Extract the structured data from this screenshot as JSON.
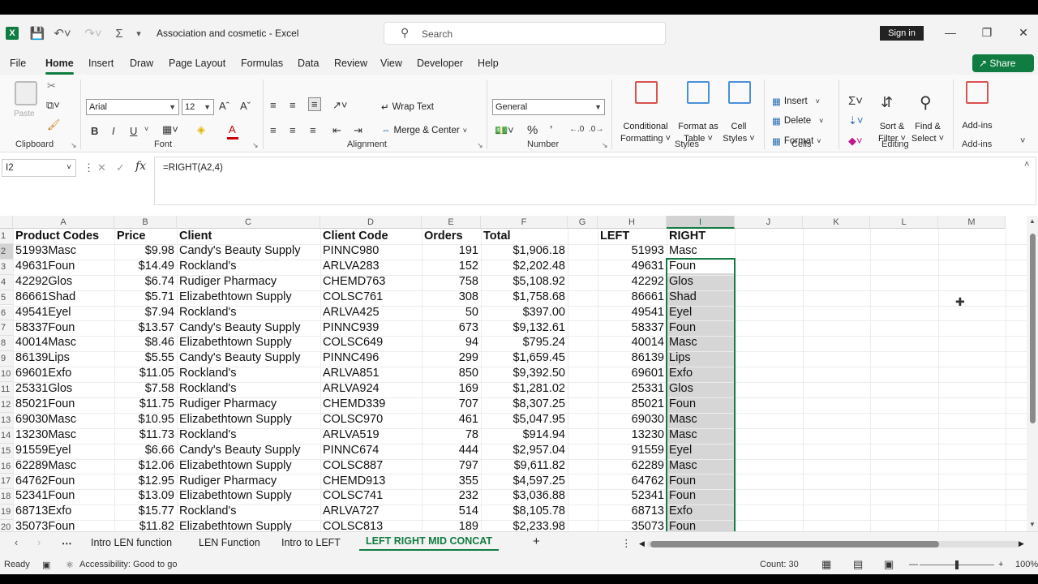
{
  "app": {
    "logo_letter": "X",
    "doc_title": "Association and cosmetic  -  Excel",
    "search_placeholder": "Search",
    "sign_in": "Sign in",
    "share": "Share"
  },
  "menu": [
    "File",
    "Home",
    "Insert",
    "Draw",
    "Page Layout",
    "Formulas",
    "Data",
    "Review",
    "View",
    "Developer",
    "Help"
  ],
  "ribbon": {
    "font_name": "Arial",
    "font_size": "12",
    "wrap_text": "Wrap Text",
    "merge_center": "Merge & Center",
    "number_format": "General",
    "conditional_formatting": [
      "Conditional",
      "Formatting"
    ],
    "format_as_table": [
      "Format as",
      "Table"
    ],
    "cell_styles": [
      "Cell",
      "Styles"
    ],
    "insert": "Insert",
    "delete": "Delete",
    "format": "Format",
    "sort_filter": [
      "Sort &",
      "Filter"
    ],
    "find_select": [
      "Find &",
      "Select"
    ],
    "addins": "Add-ins",
    "groups": {
      "clipboard": "Clipboard",
      "font": "Font",
      "alignment": "Alignment",
      "number": "Number",
      "styles": "Styles",
      "cells": "Cells",
      "editing": "Editing",
      "addins": "Add-ins"
    },
    "paste": "Paste"
  },
  "formula_bar": {
    "name_box": "I2",
    "fx": "fx",
    "formula": "=RIGHT(A2,4)"
  },
  "columns": [
    "A",
    "B",
    "C",
    "D",
    "E",
    "F",
    "G",
    "H",
    "I",
    "J",
    "K",
    "L",
    "M"
  ],
  "headers": [
    "Product Codes",
    "Price",
    "Client",
    "Client Code",
    "Orders",
    "Total",
    "",
    "LEFT",
    "RIGHT"
  ],
  "rows": [
    [
      "51993Masc",
      "$9.98",
      "Candy's Beauty Supply",
      "PINNC980",
      "191",
      "$1,906.18",
      "",
      "51993",
      "Masc"
    ],
    [
      "49631Foun",
      "$14.49",
      "Rockland's",
      "ARLVA283",
      "152",
      "$2,202.48",
      "",
      "49631",
      "Foun"
    ],
    [
      "42292Glos",
      "$6.74",
      "Rudiger Pharmacy",
      "CHEMD763",
      "758",
      "$5,108.92",
      "",
      "42292",
      "Glos"
    ],
    [
      "86661Shad",
      "$5.71",
      "Elizabethtown Supply",
      "COLSC761",
      "308",
      "$1,758.68",
      "",
      "86661",
      "Shad"
    ],
    [
      "49541Eyel",
      "$7.94",
      "Rockland's",
      "ARLVA425",
      "50",
      "$397.00",
      "",
      "49541",
      "Eyel"
    ],
    [
      "58337Foun",
      "$13.57",
      "Candy's Beauty Supply",
      "PINNC939",
      "673",
      "$9,132.61",
      "",
      "58337",
      "Foun"
    ],
    [
      "40014Masc",
      "$8.46",
      "Elizabethtown Supply",
      "COLSC649",
      "94",
      "$795.24",
      "",
      "40014",
      "Masc"
    ],
    [
      "86139Lips",
      "$5.55",
      "Candy's Beauty Supply",
      "PINNC496",
      "299",
      "$1,659.45",
      "",
      "86139",
      "Lips"
    ],
    [
      "69601Exfo",
      "$11.05",
      "Rockland's",
      "ARLVA851",
      "850",
      "$9,392.50",
      "",
      "69601",
      "Exfo"
    ],
    [
      "25331Glos",
      "$7.58",
      "Rockland's",
      "ARLVA924",
      "169",
      "$1,281.02",
      "",
      "25331",
      "Glos"
    ],
    [
      "85021Foun",
      "$11.75",
      "Rudiger Pharmacy",
      "CHEMD339",
      "707",
      "$8,307.25",
      "",
      "85021",
      "Foun"
    ],
    [
      "69030Masc",
      "$10.95",
      "Elizabethtown Supply",
      "COLSC970",
      "461",
      "$5,047.95",
      "",
      "69030",
      "Masc"
    ],
    [
      "13230Masc",
      "$11.73",
      "Rockland's",
      "ARLVA519",
      "78",
      "$914.94",
      "",
      "13230",
      "Masc"
    ],
    [
      "91559Eyel",
      "$6.66",
      "Candy's Beauty Supply",
      "PINNC674",
      "444",
      "$2,957.04",
      "",
      "91559",
      "Eyel"
    ],
    [
      "62289Masc",
      "$12.06",
      "Elizabethtown Supply",
      "COLSC887",
      "797",
      "$9,611.82",
      "",
      "62289",
      "Masc"
    ],
    [
      "64762Foun",
      "$12.95",
      "Rudiger Pharmacy",
      "CHEMD913",
      "355",
      "$4,597.25",
      "",
      "64762",
      "Foun"
    ],
    [
      "52341Foun",
      "$13.09",
      "Elizabethtown Supply",
      "COLSC741",
      "232",
      "$3,036.88",
      "",
      "52341",
      "Foun"
    ],
    [
      "68713Exfo",
      "$15.77",
      " Rockland's",
      "ARLVA727",
      "514",
      "$8,105.78",
      "",
      "68713",
      "Exfo"
    ],
    [
      "35073Foun",
      "$11.82",
      "Elizabethtown Supply",
      "COLSC813",
      "189",
      "$2,233.98",
      "",
      "35073",
      "Foun"
    ]
  ],
  "sheet_tabs": [
    "Intro LEN function",
    "LEN Function",
    "Intro to LEFT",
    "LEFT RIGHT MID CONCAT"
  ],
  "status": {
    "ready": "Ready",
    "accessibility": "Accessibility: Good to go",
    "count": "Count: 30",
    "zoom": "100%"
  },
  "colors": {
    "accent": "#107c41",
    "selection": "#d6d6d6"
  }
}
